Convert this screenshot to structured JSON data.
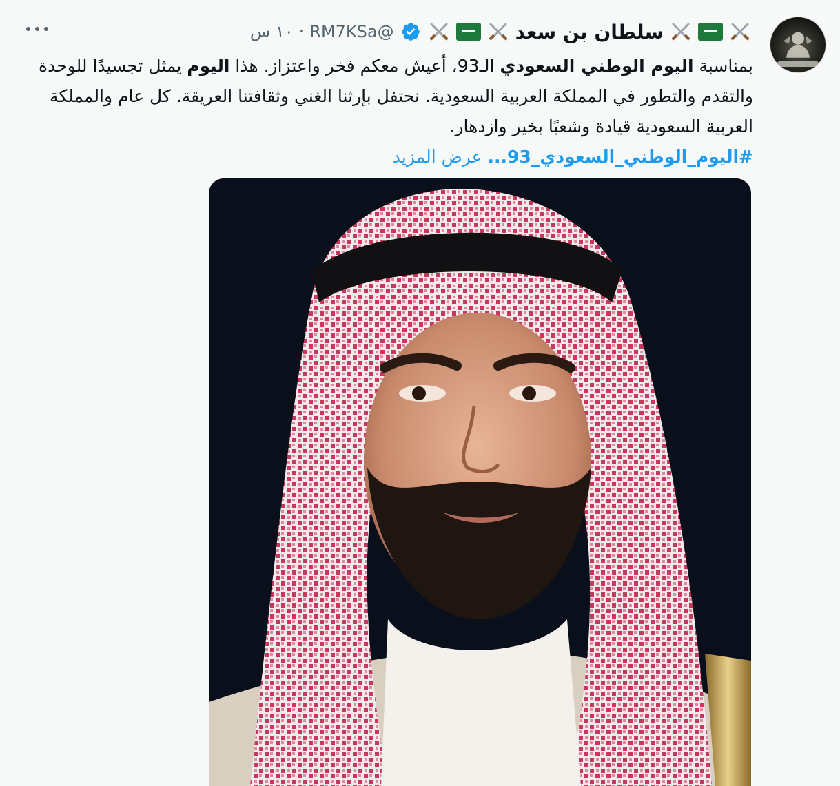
{
  "tweet": {
    "author_name": "سلطان بن سعد",
    "handle": "@RM7KSa",
    "time": "١٠ س",
    "separator": "·",
    "text_segments": {
      "p1_a": "بمناسبة ",
      "p1_b": "اليوم الوطني السعودي",
      "p1_c": " الـ93، أعيش معكم فخر واعتزاز. هذا ",
      "p1_d": "اليوم",
      "p1_e": " يمثل تجسيدًا للوحدة والتقدم والتطور في المملكة العربية السعودية. نحتفل بإرثنا الغني وثقافتنا العريقة. كل عام والمملكة العربية السعودية قيادة وشعبًا بخير وازدهار."
    },
    "hashtag": "#اليوم_الوطني_السعودي_93...",
    "show_more": "عرض المزيد"
  },
  "icons": {
    "avatar": "profile-avatar",
    "verified": "verified-badge-icon",
    "flag": "saudi-flag-emoji",
    "swords": "crossed-swords-emoji",
    "more": "more-options-icon"
  },
  "colors": {
    "background": "#f7f9f9",
    "text": "#0f1419",
    "secondary": "#536471",
    "link": "#1d9bf0",
    "verified": "#1d9bf0",
    "flag_green": "#1d7a3c"
  }
}
